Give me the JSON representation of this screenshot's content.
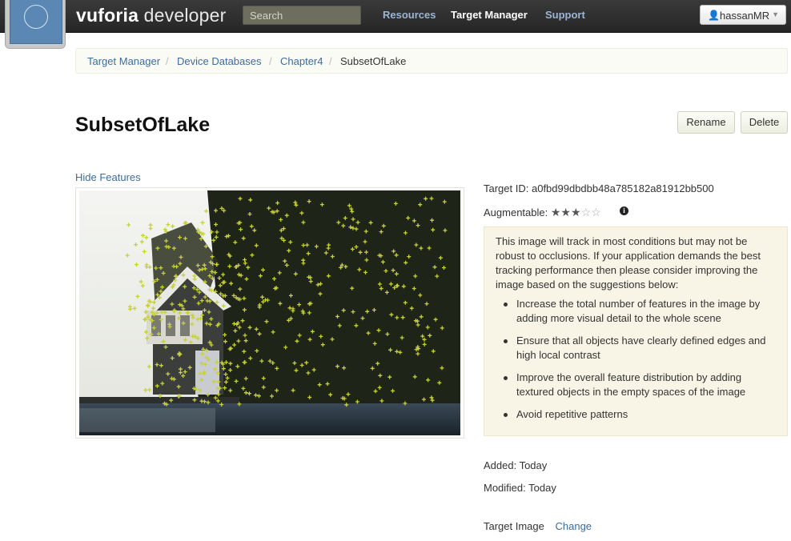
{
  "navbar": {
    "brand_bold": "vuforia",
    "brand_rest": " developer",
    "search_placeholder": "Search",
    "links": [
      "Resources",
      "Target Manager",
      "Support"
    ],
    "active_link": "Target Manager",
    "user": "hassanMR"
  },
  "breadcrumb": {
    "items": [
      "Target Manager",
      "Device Databases",
      "Chapter4"
    ],
    "current": "SubsetOfLake",
    "separator": "/"
  },
  "page": {
    "title": "SubsetOfLake",
    "rename_label": "Rename",
    "delete_label": "Delete",
    "hide_features_label": "Hide Features"
  },
  "target": {
    "id_label": "Target ID:",
    "id_value": "a0fbd99dbdbb48a785182a81912bb500",
    "augmentable_label": "Augmentable:",
    "rating": 3,
    "rating_max": 5,
    "advice_text": "This image will track in most conditions but may not be robust to occlusions. If your application demands the best tracking performance then please consider improving the image based on the suggestions below:",
    "suggestions": [
      "Increase the total number of features in the image by adding more visual detail to the whole scene",
      "Ensure that all objects have clearly defined edges and high local contrast",
      "Improve the overall feature distribution by adding textured objects in the empty spaces of the image",
      "Avoid repetitive patterns"
    ],
    "added": "Added: Today",
    "modified": "Modified: Today",
    "target_image_label": "Target Image",
    "change_label": "Change"
  },
  "colors": {
    "navbar": "#2e2e2e",
    "link": "#3d6b9a",
    "advice_bg": "#f8f4e6",
    "feature_marker": "#c8d038"
  }
}
